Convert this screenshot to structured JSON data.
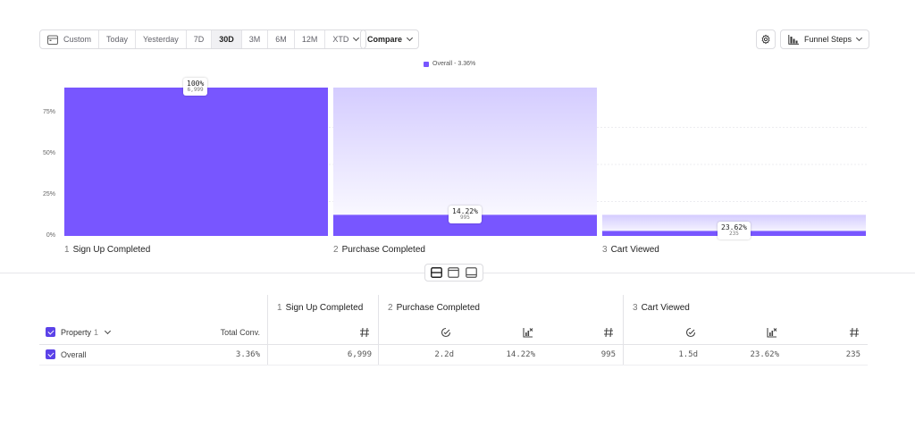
{
  "toolbar": {
    "date_ranges": [
      "Custom",
      "Today",
      "Yesterday",
      "7D",
      "30D",
      "3M",
      "6M",
      "12M",
      "XTD"
    ],
    "active_range": "30D",
    "compare_label": "Compare",
    "funnel_steps_label": "Funnel Steps"
  },
  "legend": {
    "label": "Overall - 3.36%",
    "color": "#7856ff"
  },
  "chart_data": {
    "type": "bar",
    "categories": [
      "Sign Up Completed",
      "Purchase Completed",
      "Cart Viewed"
    ],
    "step_numbers": [
      "1",
      "2",
      "3"
    ],
    "series": [
      {
        "name": "Overall - 3.36%",
        "values": [
          100,
          14.22,
          3.36
        ]
      }
    ],
    "data_labels": [
      {
        "pct": "100%",
        "count": "6,999"
      },
      {
        "pct": "14.22%",
        "count": "995"
      },
      {
        "pct": "23.62%",
        "count": "235"
      }
    ],
    "y_ticks": [
      "0%",
      "25%",
      "50%",
      "75%"
    ],
    "ylim": [
      0,
      100
    ],
    "colors": {
      "bar": "#7856ff",
      "dropoff": "#d9d2ff"
    }
  },
  "table": {
    "property_label": "Property",
    "property_count": "1",
    "total_conv_label": "Total Conv.",
    "steps": [
      {
        "num": "1",
        "name": "Sign Up Completed"
      },
      {
        "num": "2",
        "name": "Purchase Completed"
      },
      {
        "num": "3",
        "name": "Cart Viewed"
      }
    ],
    "rows": [
      {
        "name": "Overall",
        "total_conv": "3.36%",
        "step1_count": "6,999",
        "step2_time": "2.2d",
        "step2_conv": "14.22%",
        "step2_count": "995",
        "step3_time": "1.5d",
        "step3_conv": "23.62%",
        "step3_count": "235"
      }
    ]
  }
}
